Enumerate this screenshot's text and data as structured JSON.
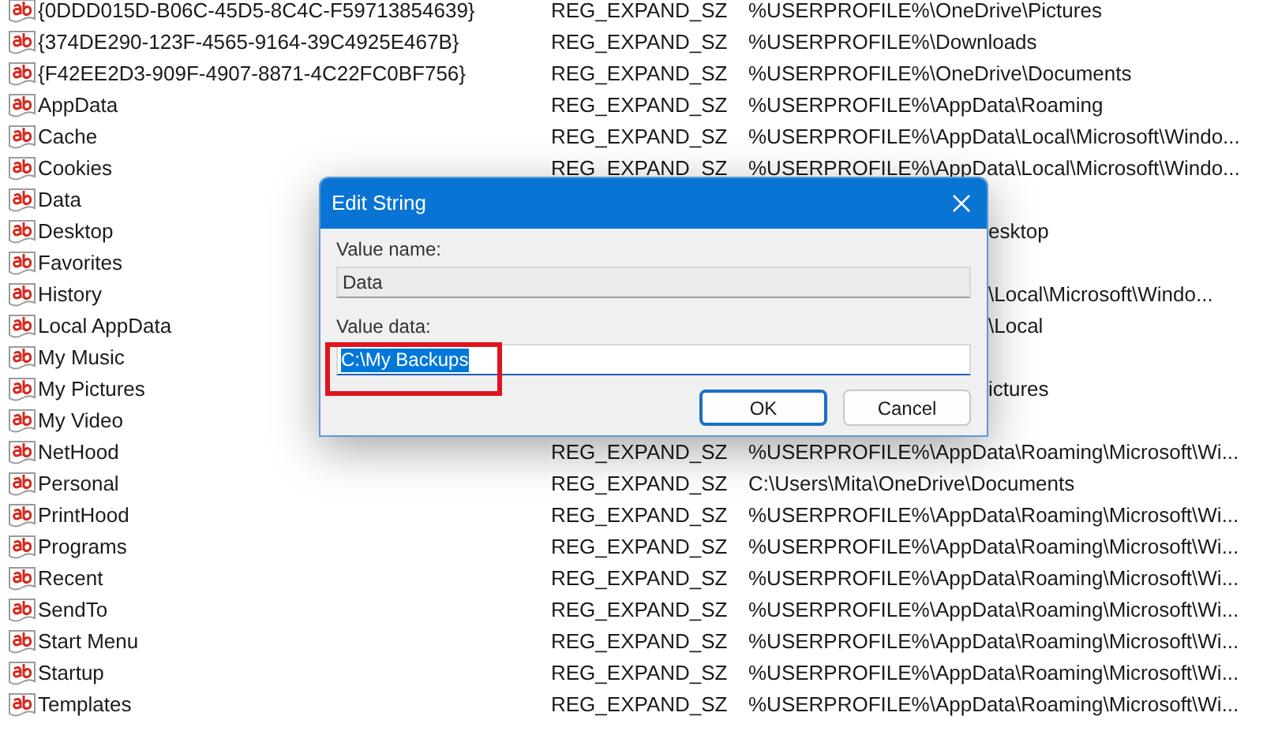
{
  "rows": [
    {
      "name": "{0DDD015D-B06C-45D5-8C4C-F59713854639}",
      "type": "REG_EXPAND_SZ",
      "data": "%USERPROFILE%\\OneDrive\\Pictures"
    },
    {
      "name": "{374DE290-123F-4565-9164-39C4925E467B}",
      "type": "REG_EXPAND_SZ",
      "data": "%USERPROFILE%\\Downloads"
    },
    {
      "name": "{F42EE2D3-909F-4907-8871-4C22FC0BF756}",
      "type": "REG_EXPAND_SZ",
      "data": "%USERPROFILE%\\OneDrive\\Documents"
    },
    {
      "name": "AppData",
      "type": "REG_EXPAND_SZ",
      "data": "%USERPROFILE%\\AppData\\Roaming"
    },
    {
      "name": "Cache",
      "type": "REG_EXPAND_SZ",
      "data": "%USERPROFILE%\\AppData\\Local\\Microsoft\\Windo..."
    },
    {
      "name": "Cookies",
      "type": "REG_EXPAND_SZ",
      "data": "%USERPROFILE%\\AppData\\Local\\Microsoft\\Windo..."
    },
    {
      "name": "Data"
    },
    {
      "name": "Desktop",
      "data": "esktop",
      "kind": "partial"
    },
    {
      "name": "Favorites"
    },
    {
      "name": "History",
      "data": "\\Local\\Microsoft\\Windo...",
      "kind": "partial"
    },
    {
      "name": "Local AppData",
      "data": "\\Local",
      "kind": "partial"
    },
    {
      "name": "My Music"
    },
    {
      "name": "My Pictures",
      "data": "ictures",
      "kind": "partial"
    },
    {
      "name": "My Video"
    },
    {
      "name": "NetHood",
      "type": "REG_EXPAND_SZ",
      "data": "%USERPROFILE%\\AppData\\Roaming\\Microsoft\\Wi..."
    },
    {
      "name": "Personal",
      "type": "REG_EXPAND_SZ",
      "data": "C:\\Users\\Mita\\OneDrive\\Documents"
    },
    {
      "name": "PrintHood",
      "type": "REG_EXPAND_SZ",
      "data": "%USERPROFILE%\\AppData\\Roaming\\Microsoft\\Wi..."
    },
    {
      "name": "Programs",
      "type": "REG_EXPAND_SZ",
      "data": "%USERPROFILE%\\AppData\\Roaming\\Microsoft\\Wi..."
    },
    {
      "name": "Recent",
      "type": "REG_EXPAND_SZ",
      "data": "%USERPROFILE%\\AppData\\Roaming\\Microsoft\\Wi..."
    },
    {
      "name": "SendTo",
      "type": "REG_EXPAND_SZ",
      "data": "%USERPROFILE%\\AppData\\Roaming\\Microsoft\\Wi..."
    },
    {
      "name": "Start Menu",
      "type": "REG_EXPAND_SZ",
      "data": "%USERPROFILE%\\AppData\\Roaming\\Microsoft\\Wi..."
    },
    {
      "name": "Startup",
      "type": "REG_EXPAND_SZ",
      "data": "%USERPROFILE%\\AppData\\Roaming\\Microsoft\\Wi..."
    },
    {
      "name": "Templates",
      "type": "REG_EXPAND_SZ",
      "data": "%USERPROFILE%\\AppData\\Roaming\\Microsoft\\Wi..."
    }
  ],
  "dialog": {
    "title": "Edit String",
    "value_name_label": "Value name:",
    "value_name": "Data",
    "value_data_label": "Value data:",
    "value_data": "C:\\My Backups",
    "value_data_selected": true,
    "highlight_box": true,
    "buttons": [
      {
        "label": "OK",
        "default": true
      },
      {
        "label": "Cancel",
        "default": false
      }
    ]
  }
}
